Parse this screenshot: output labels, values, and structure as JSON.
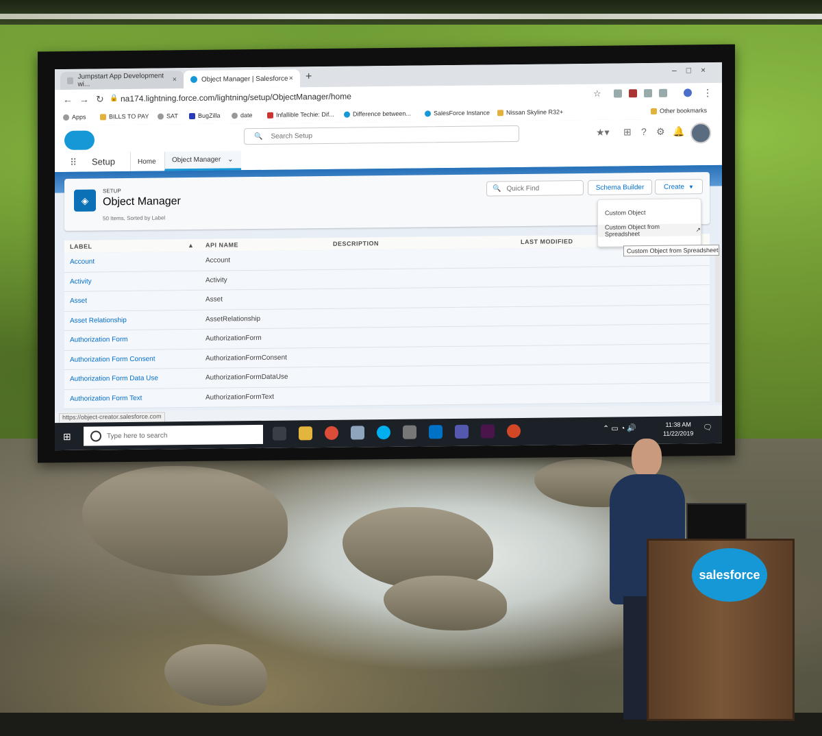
{
  "browser": {
    "tabs": [
      {
        "label": "Jumpstart App Development wi..."
      },
      {
        "label": "Object Manager | Salesforce"
      }
    ],
    "new_tab": "+",
    "url": "na174.lightning.force.com/lightning/setup/ObjectManager/home",
    "bookmarks": [
      {
        "label": "Apps"
      },
      {
        "label": "BILLS TO PAY"
      },
      {
        "label": "SAT"
      },
      {
        "label": "BugZilla"
      },
      {
        "label": "date"
      },
      {
        "label": "Infallible Techie: Dif..."
      },
      {
        "label": "Difference between..."
      },
      {
        "label": "SalesForce Instance"
      },
      {
        "label": "Nissan Skyline R32+"
      },
      {
        "label": "Other bookmarks"
      }
    ],
    "status_url": "https://object-creator.salesforce.com"
  },
  "salesforce": {
    "search_placeholder": "Search Setup",
    "app_name": "Setup",
    "nav_tabs": [
      {
        "label": "Home"
      },
      {
        "label": "Object Manager"
      }
    ]
  },
  "object_manager": {
    "eyebrow": "SETUP",
    "title": "Object Manager",
    "meta": "50 Items, Sorted by Label",
    "quick_find_placeholder": "Quick Find",
    "schema_builder_label": "Schema Builder",
    "create_label": "Create",
    "create_menu": [
      {
        "label": "Custom Object"
      },
      {
        "label": "Custom Object from Spreadsheet"
      }
    ],
    "tooltip": "Custom Object from Spreadsheet",
    "columns": {
      "label": "LABEL",
      "api_name": "API NAME",
      "description": "DESCRIPTION",
      "last_modified": "LAST MODIFIED"
    },
    "rows": [
      {
        "label": "Account",
        "api_name": "Account"
      },
      {
        "label": "Activity",
        "api_name": "Activity"
      },
      {
        "label": "Asset",
        "api_name": "Asset"
      },
      {
        "label": "Asset Relationship",
        "api_name": "AssetRelationship"
      },
      {
        "label": "Authorization Form",
        "api_name": "AuthorizationForm"
      },
      {
        "label": "Authorization Form Consent",
        "api_name": "AuthorizationFormConsent"
      },
      {
        "label": "Authorization Form Data Use",
        "api_name": "AuthorizationFormDataUse"
      },
      {
        "label": "Authorization Form Text",
        "api_name": "AuthorizationFormText"
      }
    ]
  },
  "taskbar": {
    "search_placeholder": "Type here to search",
    "time": "11:38 AM",
    "date": "11/22/2019"
  },
  "podium_logo": "salesforce",
  "colors": {
    "salesforce_blue": "#1798d6",
    "link_blue": "#006dcc",
    "taskbar": "#1c2128"
  }
}
